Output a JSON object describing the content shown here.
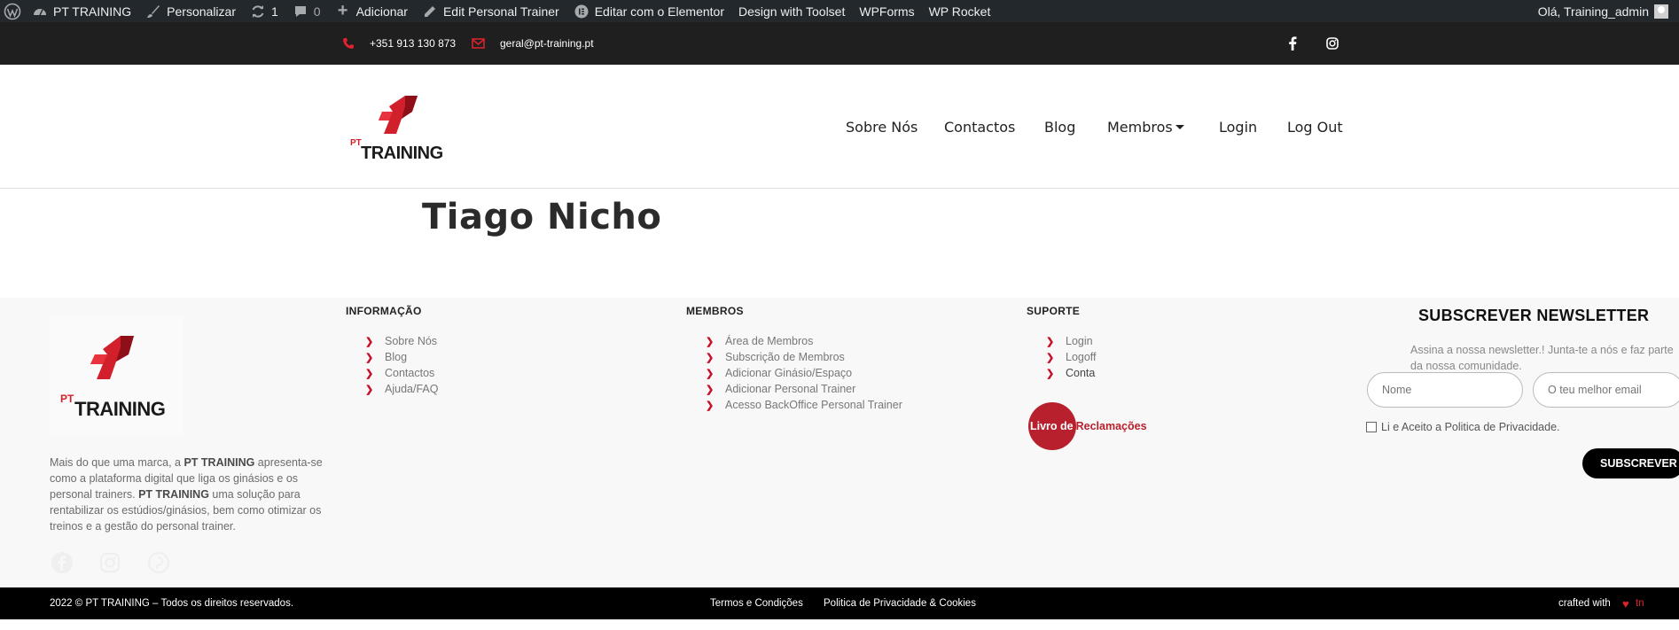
{
  "admin_bar": {
    "site_name": "PT TRAINING",
    "customize": "Personalizar",
    "updates_count": "1",
    "comments_count": "0",
    "add_new": "Adicionar",
    "edit_page": "Edit Personal Trainer",
    "elementor": "Editar com o Elementor",
    "toolset": "Design with Toolset",
    "wpforms": "WPForms",
    "wprocket": "WP Rocket",
    "greeting": "Olá, Training_admin"
  },
  "top_bar": {
    "phone": "+351 913 130 873",
    "email": "geral@pt-training.pt",
    "accent_color": "#e0222d"
  },
  "header": {
    "logo_alt": "PT TRAINING",
    "nav": [
      "Sobre Nós",
      "Contactos",
      "Blog",
      "Membros",
      "Login",
      "Log Out"
    ]
  },
  "main": {
    "title": "Tiago Nicho"
  },
  "footer": {
    "logo_alt": "PT TRAINING",
    "about_prefix": "Mais do que uma marca, a ",
    "brand": "PT TRAINING",
    "about_mid": " apresenta-se como a plataforma digital que liga os ginásios e os personal trainers. ",
    "about_suffix": " uma solução para rentabilizar os estúdios/ginásios, bem como otimizar os treinos e a gestão do personal trainer.",
    "columns": [
      {
        "title": "INFORMAÇÃO",
        "items": [
          "Sobre Nós",
          "Blog",
          "Contactos",
          "Ajuda/FAQ"
        ]
      },
      {
        "title": "MEMBROS",
        "items": [
          "Área de Membros",
          "Subscrição de Membros",
          "Adicionar Ginásio/Espaço",
          "Adicionar Personal Trainer",
          "Acesso BackOffice Personal Trainer"
        ]
      },
      {
        "title": "SUPORTE",
        "items": [
          "Login",
          "Logoff",
          "Conta"
        ]
      }
    ],
    "complaints_book": {
      "part1": "Livro de",
      "part2": "Reclamações"
    },
    "newsletter": {
      "title": "SUBSCREVER NEWSLETTER",
      "description": "Assina a nossa newsletter.! Junta-te a nós e faz parte da nossa comunidade.",
      "name_placeholder": "Nome",
      "email_placeholder": "O teu melhor email",
      "consent": "Li e Aceito a Politica de Privacidade.",
      "button": "SUBSCREVER"
    }
  },
  "bottom_bar": {
    "copyright": "2022 © PT TRAINING – Todos os direitos reservados.",
    "terms": "Termos e Condições",
    "privacy": "Politica de Privacidade & Cookies",
    "crafted": "crafted with",
    "crafted_by": "tn"
  }
}
